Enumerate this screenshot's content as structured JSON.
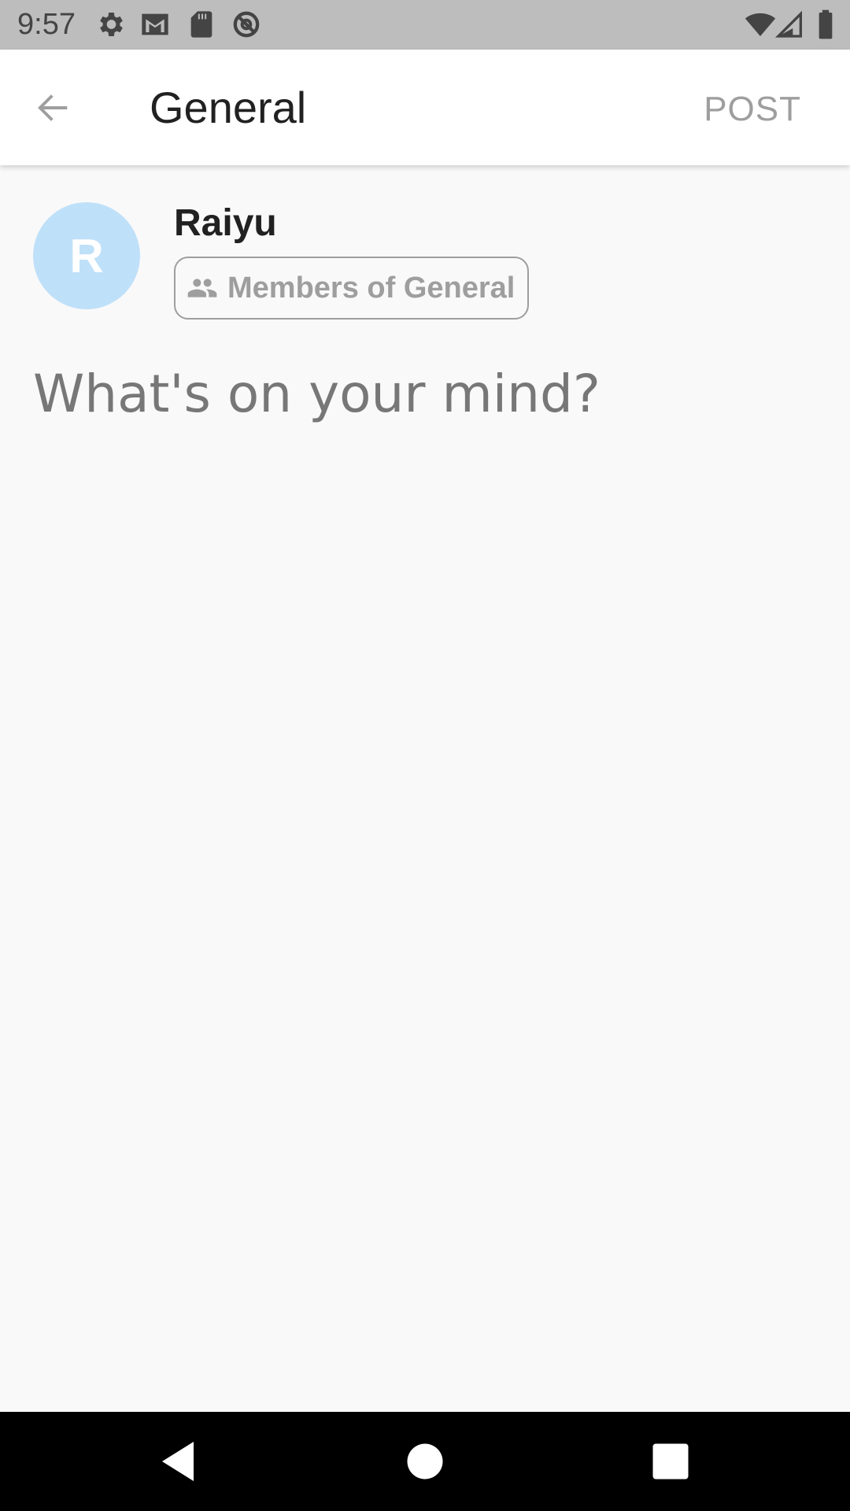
{
  "status_bar": {
    "time": "9:57",
    "left_icons": [
      "gear-icon",
      "gmail-icon",
      "sd-card-icon",
      "do-not-disturb-icon"
    ],
    "right_icons": [
      "wifi-icon",
      "cell-signal-icon",
      "battery-icon"
    ]
  },
  "app_bar": {
    "back_icon": "arrow-back-icon",
    "title": "General",
    "post_label": "POST"
  },
  "composer": {
    "avatar_letter": "R",
    "avatar_color": "#bfe0f9",
    "user_name": "Raiyu",
    "audience_icon": "people-icon",
    "audience_label": "Members of General",
    "placeholder": "What's on your mind?"
  },
  "nav_bar": {
    "icons": [
      "back-triangle-icon",
      "home-circle-icon",
      "recents-square-icon"
    ]
  }
}
